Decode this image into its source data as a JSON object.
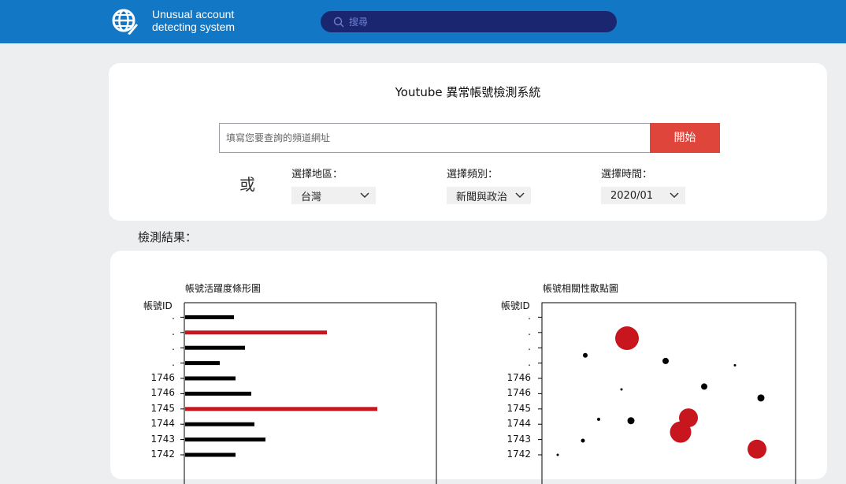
{
  "header": {
    "app_title_line1": "Unusual account",
    "app_title_line2": "detecting system",
    "logo_icon": "globe-feather-icon",
    "search_placeholder": "搜尋",
    "search_icon": "search-icon",
    "colors": {
      "bar": "#1277c4",
      "search_bg": "#1a2770"
    }
  },
  "form": {
    "title": "Youtube 異常帳號檢測系統",
    "url_placeholder": "填寫您要查詢的頻道網址",
    "start_label": "開始",
    "start_color": "#e0453c",
    "or_label": "或",
    "filters": [
      {
        "label": "選擇地區：",
        "value": "台灣"
      },
      {
        "label": "選擇頻別：",
        "value": "新聞與政治"
      },
      {
        "label": "選擇時間：",
        "value": "2020/01"
      }
    ]
  },
  "results": {
    "label": "檢測結果："
  },
  "chart_data": [
    {
      "type": "bar",
      "title": "帳號活躍度條形圖",
      "ylabel": "帳號ID",
      "orientation": "horizontal",
      "categories": [
        "1742",
        "1743",
        "1744",
        "1745",
        "1746",
        "1746",
        ".",
        ".",
        ".",
        "."
      ],
      "values": [
        32,
        51,
        44,
        122,
        42,
        32,
        22,
        38,
        90,
        31
      ],
      "highlight": [
        false,
        false,
        false,
        true,
        false,
        false,
        false,
        false,
        true,
        false
      ],
      "colors": {
        "normal": "#000000",
        "highlight": "#c8161e"
      },
      "xlim": [
        0,
        160
      ]
    },
    {
      "type": "scatter",
      "title": "帳號相關性散點圖",
      "ylabel": "帳號ID",
      "yticks": [
        "1742",
        "1743",
        "1744",
        "1745",
        "1746",
        "1746",
        ".",
        ".",
        ".",
        "."
      ],
      "points": [
        {
          "x": 20,
          "y": 0.0,
          "size": 3,
          "flag": false
        },
        {
          "x": 52,
          "y": 1.0,
          "size": 5,
          "flag": false
        },
        {
          "x": 72,
          "y": 2.5,
          "size": 4,
          "flag": false
        },
        {
          "x": 113,
          "y": 2.4,
          "size": 9,
          "flag": false
        },
        {
          "x": 101,
          "y": 4.6,
          "size": 3,
          "flag": false
        },
        {
          "x": 55,
          "y": 7.0,
          "size": 6,
          "flag": false
        },
        {
          "x": 157,
          "y": 6.6,
          "size": 8,
          "flag": false
        },
        {
          "x": 206,
          "y": 4.8,
          "size": 8,
          "flag": false
        },
        {
          "x": 245,
          "y": 6.3,
          "size": 3,
          "flag": false
        },
        {
          "x": 278,
          "y": 4.0,
          "size": 9,
          "flag": false
        },
        {
          "x": 108,
          "y": 8.2,
          "size": 22,
          "flag": true
        },
        {
          "x": 186,
          "y": 2.6,
          "size": 16,
          "flag": true
        },
        {
          "x": 176,
          "y": 1.6,
          "size": 19,
          "flag": true
        },
        {
          "x": 273,
          "y": 0.4,
          "size": 16,
          "flag": true
        }
      ],
      "colors": {
        "normal": "#000000",
        "flag": "#c8161e"
      }
    }
  ]
}
